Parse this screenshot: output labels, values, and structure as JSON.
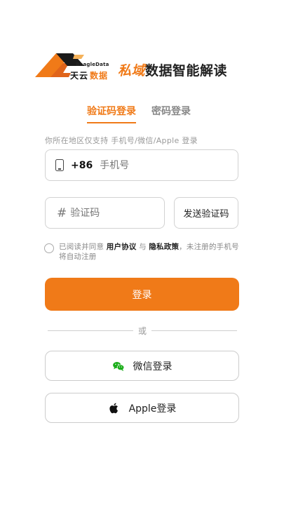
{
  "brand": {
    "logo_en": "BeagleData",
    "logo_cn_black": "天云",
    "logo_cn_orange": "数据",
    "slogan_accent": "私域",
    "slogan_rest": "数据智能解读",
    "accent_color": "#f07a18"
  },
  "tabs": [
    {
      "label": "验证码登录",
      "active": true
    },
    {
      "label": "密码登录",
      "active": false
    }
  ],
  "region_hint": "你所在地区仅支持 手机号/微信/Apple 登录",
  "phone": {
    "icon": "phone-icon",
    "prefix": "+86",
    "placeholder": "手机号",
    "value": ""
  },
  "code": {
    "icon": "hash-icon",
    "placeholder": "验证码",
    "value": "",
    "send_label": "发送验证码"
  },
  "agreement": {
    "prefix": "已阅读并同意",
    "user_agreement": "用户协议",
    "and": "与",
    "privacy_policy": "隐私政策",
    "suffix": "，未注册的手机号将自动注册",
    "checked": false
  },
  "login_label": "登录",
  "divider_label": "或",
  "wechat_login_label": "微信登录",
  "apple_login_label": "Apple登录"
}
